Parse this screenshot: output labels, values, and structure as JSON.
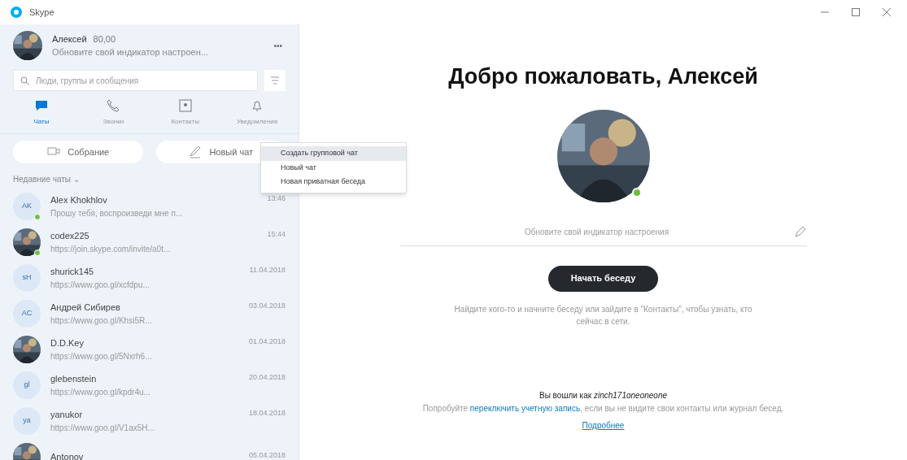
{
  "window": {
    "title": "Skype"
  },
  "profile": {
    "name": "Алексей",
    "credit": "80,00",
    "mood": "Обновите свой индикатор настроен...",
    "more": "•••"
  },
  "search": {
    "placeholder": "Люди, группы и сообщения"
  },
  "tabs": [
    {
      "label": "Чаты",
      "selected": true,
      "kind": "chat"
    },
    {
      "label": "Звонки",
      "selected": false,
      "kind": "call"
    },
    {
      "label": "Контакты",
      "selected": false,
      "kind": "contacts"
    },
    {
      "label": "Уведомления",
      "selected": false,
      "kind": "bell"
    }
  ],
  "actions": [
    {
      "label": "Собрание",
      "kind": "meeting"
    },
    {
      "label": "Новый чат",
      "kind": "newchat"
    }
  ],
  "menu": [
    {
      "label": "Создать групповой чат",
      "selected": true
    },
    {
      "label": "Новый чат",
      "selected": false
    },
    {
      "label": "Новая приватная беседа",
      "selected": false
    }
  ],
  "recent_header": "Недавние чаты ⌄",
  "chats": [
    {
      "name": "Alex Khokhlov",
      "preview": "Прошу тебя, воспроизведи мне п...",
      "time": "13:46",
      "initials": "AK",
      "online": true
    },
    {
      "name": "codex225",
      "preview": "https://join.skype.com/invite/a0t...",
      "time": "15:44",
      "kind": "picture",
      "online": true
    },
    {
      "name": "shurick145",
      "preview": "https://www.goo.gl/xcfdpu...",
      "time": "11.04.2018",
      "initials": "sH",
      "online": false
    },
    {
      "name": "Андрей Сибирев",
      "preview": "https://www.goo.gl/Khsi5R...",
      "time": "03.04.2018",
      "initials": "AC",
      "online": false
    },
    {
      "name": "D.D.Key",
      "preview": "https://www.goo.gl/5Nxrh6...",
      "time": "01.04.2018",
      "kind": "picture",
      "online": false
    },
    {
      "name": "glebenstein",
      "preview": "https://www.goo.gl/kpdr4u...",
      "time": "20.04.2018",
      "initials": "gl",
      "online": false
    },
    {
      "name": "yanukor",
      "preview": "https://www.goo.gl/V1ax5H...",
      "time": "18.04.2018",
      "initials": "ya",
      "online": false
    },
    {
      "name": "Antonov",
      "time": "05.04.2018",
      "kind": "picture",
      "online": false
    }
  ],
  "main": {
    "heading": "Добро пожаловать, Алексей",
    "mood_placeholder": "Обновите свой индикатор настроения",
    "start_button": "Начать беседу",
    "hint": "Найдите кого-то и начните беседу или зайдите в \"Контакты\", чтобы узнать, кто сейчас в сети.",
    "signed_in": "Вы вошли как *zinch171oneoneone*",
    "switch_note": "Попробуйте **переключить учетную запись**, если вы не видите свои контакты или журнал бесед.",
    "more_link": "Подробнее",
    "avatar_online": true
  }
}
